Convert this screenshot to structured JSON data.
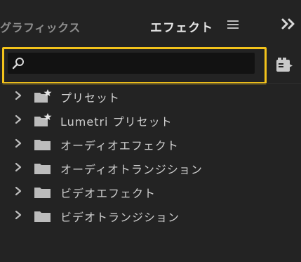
{
  "panel": {
    "tabs": [
      {
        "label": "グラフィックス",
        "active": false
      },
      {
        "label": "エフェクト",
        "active": true
      }
    ]
  },
  "search": {
    "value": "",
    "placeholder": "",
    "highlight_color": "#f3c31b"
  },
  "tree": {
    "items": [
      {
        "label": "プリセット",
        "icon": "preset-folder-icon"
      },
      {
        "label": "Lumetri プリセット",
        "icon": "preset-folder-icon"
      },
      {
        "label": "オーディオエフェクト",
        "icon": "folder-icon"
      },
      {
        "label": "オーディオトランジション",
        "icon": "folder-icon"
      },
      {
        "label": "ビデオエフェクト",
        "icon": "folder-icon"
      },
      {
        "label": "ビデオトランジション",
        "icon": "folder-icon"
      }
    ]
  }
}
